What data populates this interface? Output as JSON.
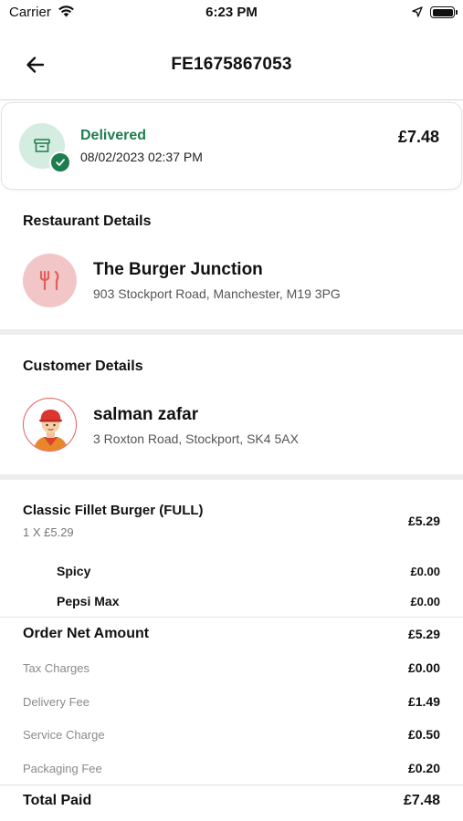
{
  "status_bar": {
    "carrier": "Carrier",
    "time": "6:23 PM"
  },
  "header": {
    "title": "FE1675867053"
  },
  "order_status": {
    "label": "Delivered",
    "datetime": "08/02/2023 02:37 PM",
    "total": "£7.48",
    "status_color": "#1e7d4f"
  },
  "restaurant": {
    "section_title": "Restaurant Details",
    "name": "The Burger Junction",
    "address": "903 Stockport Road, Manchester, M19 3PG",
    "icon": "fork-knife-icon"
  },
  "customer": {
    "section_title": "Customer Details",
    "name": "salman zafar",
    "address": "3 Roxton Road, Stockport, SK4 5AX",
    "icon": "customer-avatar"
  },
  "items": [
    {
      "name": "Classic Fillet Burger (FULL)",
      "qty_line": "1 X £5.29",
      "price": "£5.29",
      "addons": [
        {
          "name": "Spicy",
          "price": "£0.00"
        },
        {
          "name": "Pepsi Max",
          "price": "£0.00"
        }
      ]
    }
  ],
  "summary": {
    "net_label": "Order Net Amount",
    "net_value": "£5.29",
    "charges": [
      {
        "label": "Tax Charges",
        "value": "£0.00"
      },
      {
        "label": "Delivery Fee",
        "value": "£1.49"
      },
      {
        "label": "Service Charge",
        "value": "£0.50"
      },
      {
        "label": "Packaging Fee",
        "value": "£0.20"
      }
    ],
    "total_label": "Total Paid",
    "total_value": "£7.48"
  },
  "colors": {
    "accent_green": "#1e7d4f",
    "restaurant_avatar_bg": "#f2c6c7",
    "restaurant_icon": "#e0605d"
  }
}
